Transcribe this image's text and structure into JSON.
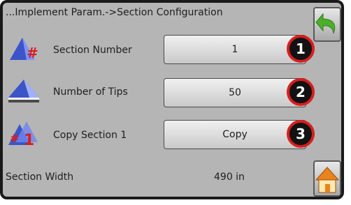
{
  "header": {
    "title": "...Implement Param.->Section Configuration"
  },
  "rows": [
    {
      "label": "Section Number",
      "value": "1",
      "callout": "1"
    },
    {
      "label": "Number of Tips",
      "value": "50",
      "callout": "2"
    },
    {
      "label": "Copy Section 1",
      "value": "Copy",
      "callout": "3"
    }
  ],
  "section_width": {
    "label": "Section Width",
    "value": "490 in"
  },
  "icons": {
    "back": "undo-arrow-icon",
    "home": "home-icon",
    "section_number": "section-number-icon",
    "tips": "tips-icon",
    "copy_section": "copy-section-icon"
  },
  "colors": {
    "screen_bg": "#b5b5b5",
    "callout_ring": "#d81e1e",
    "back_arrow": "#4caf2a",
    "home_roof": "#e8831e"
  }
}
